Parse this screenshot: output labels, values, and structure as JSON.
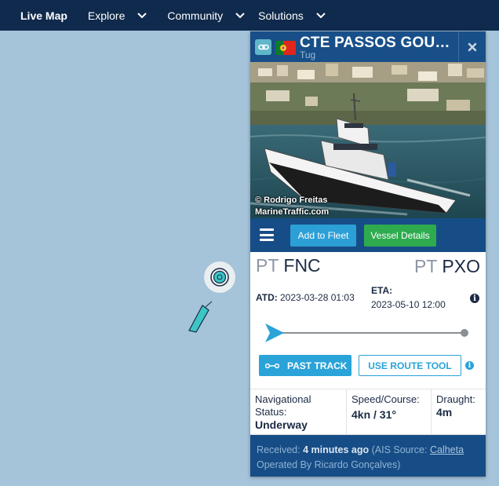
{
  "nav": {
    "live_map": "Live Map",
    "explore": "Explore",
    "community": "Community",
    "solutions": "Solutions"
  },
  "vessel": {
    "name": "CTE PASSOS GOUVEIA",
    "type": "Tug",
    "flag_icon": "flag-portugal-icon",
    "photo_credit_line1": "© Rodrigo Freitas",
    "photo_credit_line2": "MarineTraffic.com"
  },
  "actions": {
    "add_to_fleet": "Add to Fleet",
    "vessel_details": "Vessel Details"
  },
  "route": {
    "from_country": "PT",
    "from_port": "FNC",
    "to_country": "PT",
    "to_port": "PXO",
    "atd_label": "ATD:",
    "atd_value": "2023-03-28 01:03",
    "eta_label": "ETA:",
    "eta_value": "2023-05-10 12:00",
    "progress": 0
  },
  "tracks": {
    "past_track": "PAST TRACK",
    "use_route_tool": "USE ROUTE TOOL"
  },
  "stats": {
    "nav_status_label": "Navigational Status:",
    "nav_status_value": "Underway",
    "speed_label": "Speed/Course:",
    "speed_value": "4kn / 31°",
    "draught_label": "Draught:",
    "draught_value": "4m"
  },
  "footer": {
    "received_label": "Received:",
    "received_value": "4 minutes ago",
    "ais_source_prefix": "(AIS Source:",
    "ais_source": "Calheta",
    "operated_by": "Operated By Ricardo Gonçalves)"
  },
  "colors": {
    "nav_bg": "#0f2a4c",
    "panel_header": "#184f88",
    "accent_blue": "#2aa3d9",
    "accent_green": "#2eab4f",
    "map_water": "#a5c3d9"
  }
}
